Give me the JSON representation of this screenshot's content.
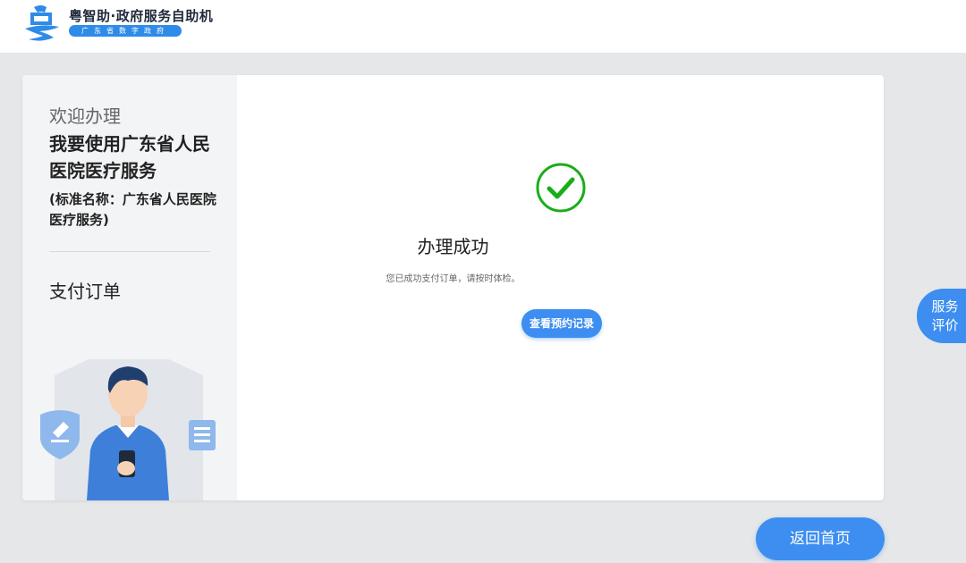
{
  "header": {
    "brand_title": "粤智助·政府服务自助机",
    "brand_subtitle": "广东省数字政府",
    "logo_icon": "yue-logo-icon",
    "brand_color": "#2f8be8"
  },
  "sidebar": {
    "welcome": "欢迎办理",
    "service_title": "我要使用广东省人民医院医疗服务",
    "service_standard_name": "(标准名称：广东省人民医院医疗服务)",
    "current_step": "支付订单",
    "illustration_icon": "service-staff-illustration"
  },
  "main": {
    "status_icon": "check-circle-icon",
    "status_color": "#1aad19",
    "result_title": "办理成功",
    "result_description": "您已成功支付订单，请按时体检。",
    "view_records_label": "查看预约记录"
  },
  "floating": {
    "rating_label_line1": "服务",
    "rating_label_line2": "评价"
  },
  "footer": {
    "home_label": "返回首页",
    "accent_color": "#3d8ef0"
  }
}
